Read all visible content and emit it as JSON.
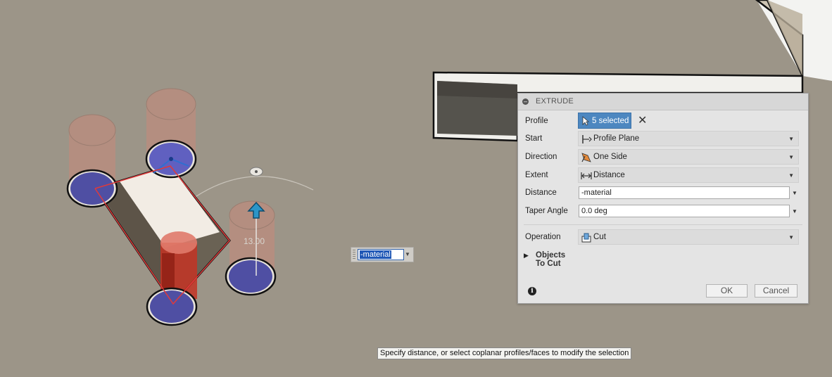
{
  "canvas": {
    "dimension_value": "13.00"
  },
  "floating_input": {
    "value": "-material"
  },
  "dialog": {
    "title": "EXTRUDE",
    "rows": {
      "profile": {
        "label": "Profile",
        "button_text": "5 selected"
      },
      "start": {
        "label": "Start",
        "value": "Profile Plane",
        "icon": "profile-plane-icon"
      },
      "direction": {
        "label": "Direction",
        "value": "One Side",
        "icon": "one-side-icon"
      },
      "extent": {
        "label": "Extent",
        "value": "Distance",
        "icon": "distance-icon"
      },
      "distance": {
        "label": "Distance",
        "value": "-material"
      },
      "taper": {
        "label": "Taper Angle",
        "value": "0.0 deg"
      },
      "operation": {
        "label": "Operation",
        "value": "Cut",
        "icon": "cut-icon"
      }
    },
    "objects_to_cut": "Objects To Cut",
    "ok_label": "OK",
    "cancel_label": "Cancel"
  },
  "tooltip": "Specify distance, or select coplanar profiles/faces to modify the selection",
  "colors": {
    "background": "#9c9588",
    "accent": "#4d87c0",
    "profile_fill": "#4f4fa3",
    "cut_red": "#c0392b"
  }
}
